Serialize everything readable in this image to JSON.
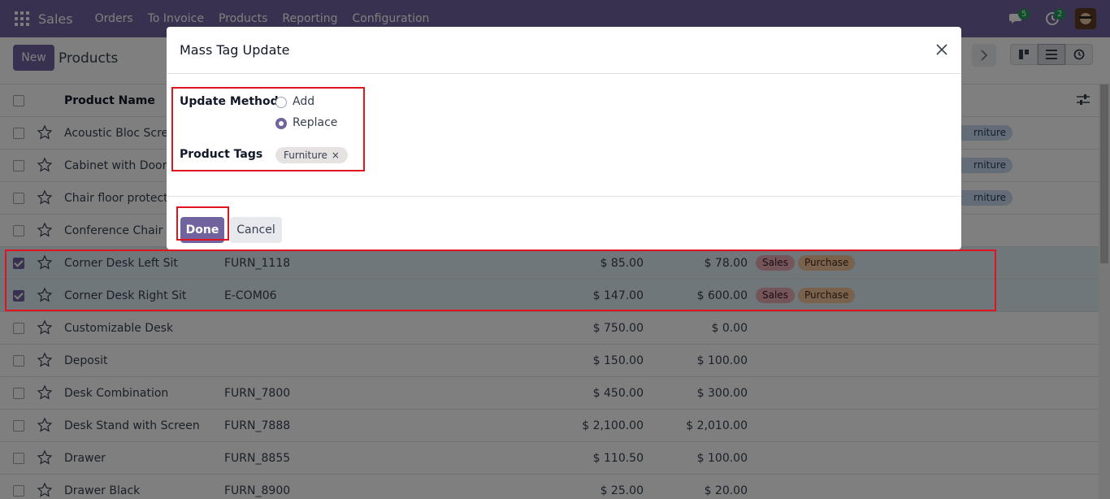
{
  "navbar": {
    "app_name": "Sales",
    "menu": [
      "Orders",
      "To Invoice",
      "Products",
      "Reporting",
      "Configuration"
    ],
    "messages_count": "5",
    "activities_count": "2"
  },
  "control_panel": {
    "new_label": "New",
    "title": "Products"
  },
  "list": {
    "header_name": "Product Name",
    "rows": [
      {
        "name": "Acoustic Bloc Screens",
        "ref": "",
        "price": "",
        "cost": "",
        "tags": [
          "Furniture"
        ],
        "checked": false
      },
      {
        "name": "Cabinet with Doors",
        "ref": "",
        "price": "",
        "cost": "",
        "tags": [
          "Furniture"
        ],
        "checked": false
      },
      {
        "name": "Chair floor protection",
        "ref": "",
        "price": "",
        "cost": "",
        "tags": [
          "Furniture"
        ],
        "checked": false
      },
      {
        "name": "Conference Chair",
        "ref": "",
        "price": "",
        "cost": "",
        "tags": [],
        "checked": false
      },
      {
        "name": "Corner Desk Left Sit",
        "ref": "FURN_1118",
        "price": "$ 85.00",
        "cost": "$ 78.00",
        "tags": [
          "Sales",
          "Purchase"
        ],
        "checked": true
      },
      {
        "name": "Corner Desk Right Sit",
        "ref": "E-COM06",
        "price": "$ 147.00",
        "cost": "$ 600.00",
        "tags": [
          "Sales",
          "Purchase"
        ],
        "checked": true
      },
      {
        "name": "Customizable Desk",
        "ref": "",
        "price": "$ 750.00",
        "cost": "$ 0.00",
        "tags": [],
        "checked": false
      },
      {
        "name": "Deposit",
        "ref": "",
        "price": "$ 150.00",
        "cost": "$ 100.00",
        "tags": [],
        "checked": false
      },
      {
        "name": "Desk Combination",
        "ref": "FURN_7800",
        "price": "$ 450.00",
        "cost": "$ 300.00",
        "tags": [],
        "checked": false
      },
      {
        "name": "Desk Stand with Screen",
        "ref": "FURN_7888",
        "price": "$ 2,100.00",
        "cost": "$ 2,010.00",
        "tags": [],
        "checked": false
      },
      {
        "name": "Drawer",
        "ref": "FURN_8855",
        "price": "$ 110.50",
        "cost": "$ 100.00",
        "tags": [],
        "checked": false
      },
      {
        "name": "Drawer Black",
        "ref": "FURN_8900",
        "price": "$ 25.00",
        "cost": "$ 20.00",
        "tags": [],
        "checked": false
      }
    ],
    "furniture_tag_partial": "rniture"
  },
  "dialog": {
    "title": "Mass Tag Update",
    "update_method_label": "Update Method",
    "option_add": "Add",
    "option_replace": "Replace",
    "product_tags_label": "Product Tags",
    "tag_value": "Furniture",
    "chip_remove": "×",
    "done_label": "Done",
    "cancel_label": "Cancel"
  },
  "colors": {
    "brand": "#71639e",
    "highlight": "#e0141e"
  }
}
